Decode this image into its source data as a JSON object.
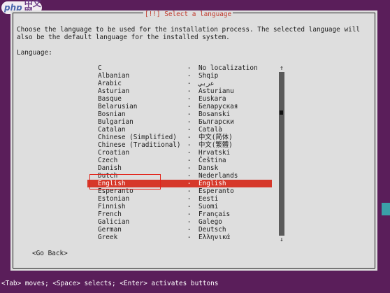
{
  "watermark": {
    "brand": "php",
    "site": "中文网"
  },
  "dialog": {
    "title": "[!!] Select a language",
    "description": "Choose the language to be used for the installation process. The selected language will\nalso be the default language for the installed system.",
    "list_label": "Language:"
  },
  "languages": [
    {
      "name": "C",
      "native": "No localization"
    },
    {
      "name": "Albanian",
      "native": "Shqip"
    },
    {
      "name": "Arabic",
      "native": "عربي"
    },
    {
      "name": "Asturian",
      "native": "Asturianu"
    },
    {
      "name": "Basque",
      "native": "Euskara"
    },
    {
      "name": "Belarusian",
      "native": "Беларуская"
    },
    {
      "name": "Bosnian",
      "native": "Bosanski"
    },
    {
      "name": "Bulgarian",
      "native": "Български"
    },
    {
      "name": "Catalan",
      "native": "Català"
    },
    {
      "name": "Chinese (Simplified)",
      "native": "中文(简体)"
    },
    {
      "name": "Chinese (Traditional)",
      "native": "中文(繁體)"
    },
    {
      "name": "Croatian",
      "native": "Hrvatski"
    },
    {
      "name": "Czech",
      "native": "Čeština"
    },
    {
      "name": "Danish",
      "native": "Dansk"
    },
    {
      "name": "Dutch",
      "native": "Nederlands"
    },
    {
      "name": "English",
      "native": "English",
      "selected": true
    },
    {
      "name": "Esperanto",
      "native": "Esperanto"
    },
    {
      "name": "Estonian",
      "native": "Eesti"
    },
    {
      "name": "Finnish",
      "native": "Suomi"
    },
    {
      "name": "French",
      "native": "Français"
    },
    {
      "name": "Galician",
      "native": "Galego"
    },
    {
      "name": "German",
      "native": "Deutsch"
    },
    {
      "name": "Greek",
      "native": "Ελληνικά"
    }
  ],
  "separator": "-",
  "scrollbar": {
    "up": "↑",
    "down": "↓"
  },
  "buttons": {
    "go_back": "<Go Back>"
  },
  "statusbar": {
    "text": "<Tab> moves; <Space> selects; <Enter> activates buttons"
  },
  "colors": {
    "background": "#5a1e5a",
    "dialog": "#dedede",
    "selection": "#d6382a",
    "title": "#c0392b"
  }
}
